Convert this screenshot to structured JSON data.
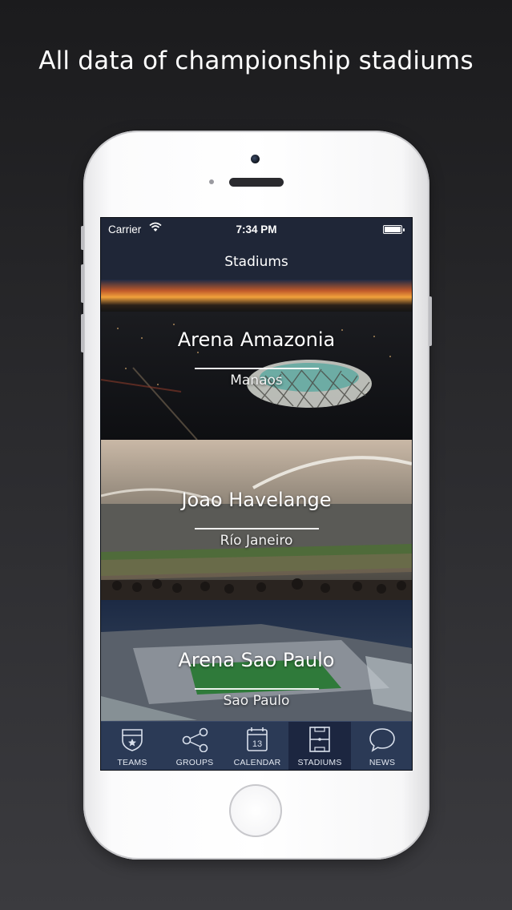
{
  "headline": "All data of championship stadiums",
  "status_bar": {
    "carrier": "Carrier",
    "time": "7:34 PM"
  },
  "nav": {
    "title": "Stadiums"
  },
  "stadiums": [
    {
      "name": "Arena Amazonia",
      "city": "Manaos"
    },
    {
      "name": "Joao Havelange",
      "city": "Río Janeiro"
    },
    {
      "name": "Arena Sao Paulo",
      "city": "Sao Paulo"
    }
  ],
  "tabs": [
    {
      "label": "TEAMS",
      "icon": "shield-icon"
    },
    {
      "label": "GROUPS",
      "icon": "share-nodes-icon"
    },
    {
      "label": "CALENDAR",
      "icon": "calendar-icon",
      "calendar_day": "13"
    },
    {
      "label": "STADIUMS",
      "icon": "pitch-icon",
      "active": true
    },
    {
      "label": "NEWS",
      "icon": "chat-bubble-icon"
    }
  ],
  "colors": {
    "nav_bg": "#1f2637",
    "tabbar_bg": "#2b3a56",
    "tab_active_bg": "#1c2640",
    "text": "#ffffff"
  }
}
